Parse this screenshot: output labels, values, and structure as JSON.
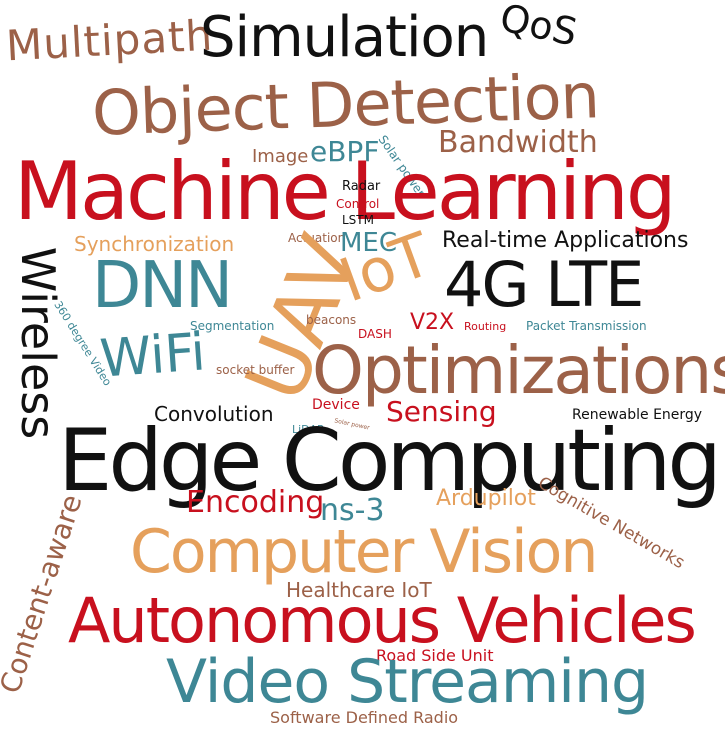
{
  "colors": {
    "black": "#111111",
    "red": "#c8101e",
    "brown": "#9c6148",
    "tan": "#e5a05c",
    "teal": "#3e8795"
  },
  "words": {
    "multipath": "Multipath",
    "simulation": "Simulation",
    "qos": "QoS",
    "object_detection": "Object Detection",
    "image": "Image",
    "ebpf": "eBPF",
    "solar_power": "Solar power",
    "bandwidth": "Bandwidth",
    "machine_learning": "Machine Learning",
    "radar": "Radar",
    "control": "Control",
    "lstm": "LSTM",
    "wireless": "Wireless",
    "synchronization": "Synchronization",
    "actuation": "Actuation",
    "mec": "MEC",
    "real_time_applications": "Real-time Applications",
    "dnn": "DNN",
    "uav": "UAV",
    "iot": "IoT",
    "lte": "4G LTE",
    "degree_video": "360 degree Video",
    "segmentation": "Segmentation",
    "beacons": "beacons",
    "v2x": "V2X",
    "routing": "Routing",
    "packet_transmission": "Packet Transmission",
    "wifi": "WiFi",
    "dash": "DASH",
    "socket_buffer": "socket buffer",
    "optimizations": "Optimizations",
    "convolution": "Convolution",
    "device": "Device",
    "sensing": "Sensing",
    "renewable_energy": "Renewable Energy",
    "lidar": "LiDAR",
    "solar_power_small": "Solar power",
    "edge_computing": "Edge Computing",
    "content_aware": "Content-aware",
    "encoding": "Encoding",
    "ns3": "ns-3",
    "ardupilot": "Ardupilot",
    "cognitive_networks": "Cognitive Networks",
    "computer_vision": "Computer Vision",
    "healthcare_iot": "Healthcare IoT",
    "autonomous_vehicles": "Autonomous Vehicles",
    "road_side_unit": "Road Side Unit",
    "video_streaming": "Video Streaming",
    "software_defined_radio": "Software Defined Radio"
  }
}
